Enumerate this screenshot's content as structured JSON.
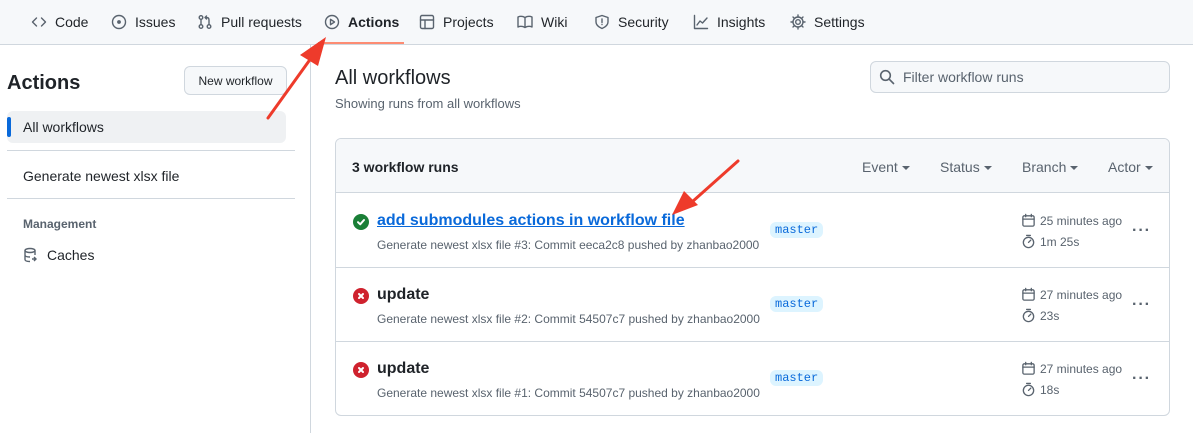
{
  "nav": {
    "tabs": [
      {
        "label": "Code",
        "icon": "code-icon"
      },
      {
        "label": "Issues",
        "icon": "issue-icon"
      },
      {
        "label": "Pull requests",
        "icon": "pull-request-icon"
      },
      {
        "label": "Actions",
        "icon": "play-icon"
      },
      {
        "label": "Projects",
        "icon": "table-icon"
      },
      {
        "label": "Wiki",
        "icon": "book-icon"
      },
      {
        "label": "Security",
        "icon": "shield-icon"
      },
      {
        "label": "Insights",
        "icon": "graph-icon"
      },
      {
        "label": "Settings",
        "icon": "gear-icon"
      }
    ],
    "active_tab": "Actions"
  },
  "sidebar": {
    "title": "Actions",
    "new_workflow_label": "New workflow",
    "all_workflows_label": "All workflows",
    "workflow_item": "Generate newest xlsx file",
    "management_heading": "Management",
    "caches_label": "Caches"
  },
  "main": {
    "title": "All workflows",
    "subtitle": "Showing runs from all workflows",
    "filter_placeholder": "Filter workflow runs",
    "run_count": "3 workflow runs",
    "filters": {
      "event": "Event",
      "status": "Status",
      "branch": "Branch",
      "actor": "Actor"
    },
    "runs": [
      {
        "title": "add submodules actions in workflow file",
        "status": "success",
        "meta": "Generate newest xlsx file #3: Commit eeca2c8 pushed by zhanbao2000",
        "branch": "master",
        "time_ago": "25 minutes ago",
        "duration": "1m 25s"
      },
      {
        "title": "update",
        "status": "failure",
        "meta": "Generate newest xlsx file #2: Commit 54507c7 pushed by zhanbao2000",
        "branch": "master",
        "time_ago": "27 minutes ago",
        "duration": "23s"
      },
      {
        "title": "update",
        "status": "failure",
        "meta": "Generate newest xlsx file #1: Commit 54507c7 pushed by zhanbao2000",
        "branch": "master",
        "time_ago": "27 minutes ago",
        "duration": "18s"
      }
    ]
  },
  "colors": {
    "accent": "#0969da",
    "success": "#1a7f37",
    "failure": "#cf222e",
    "annotation_arrow": "#ee3b2b",
    "tab_underline": "#fd8c73"
  }
}
